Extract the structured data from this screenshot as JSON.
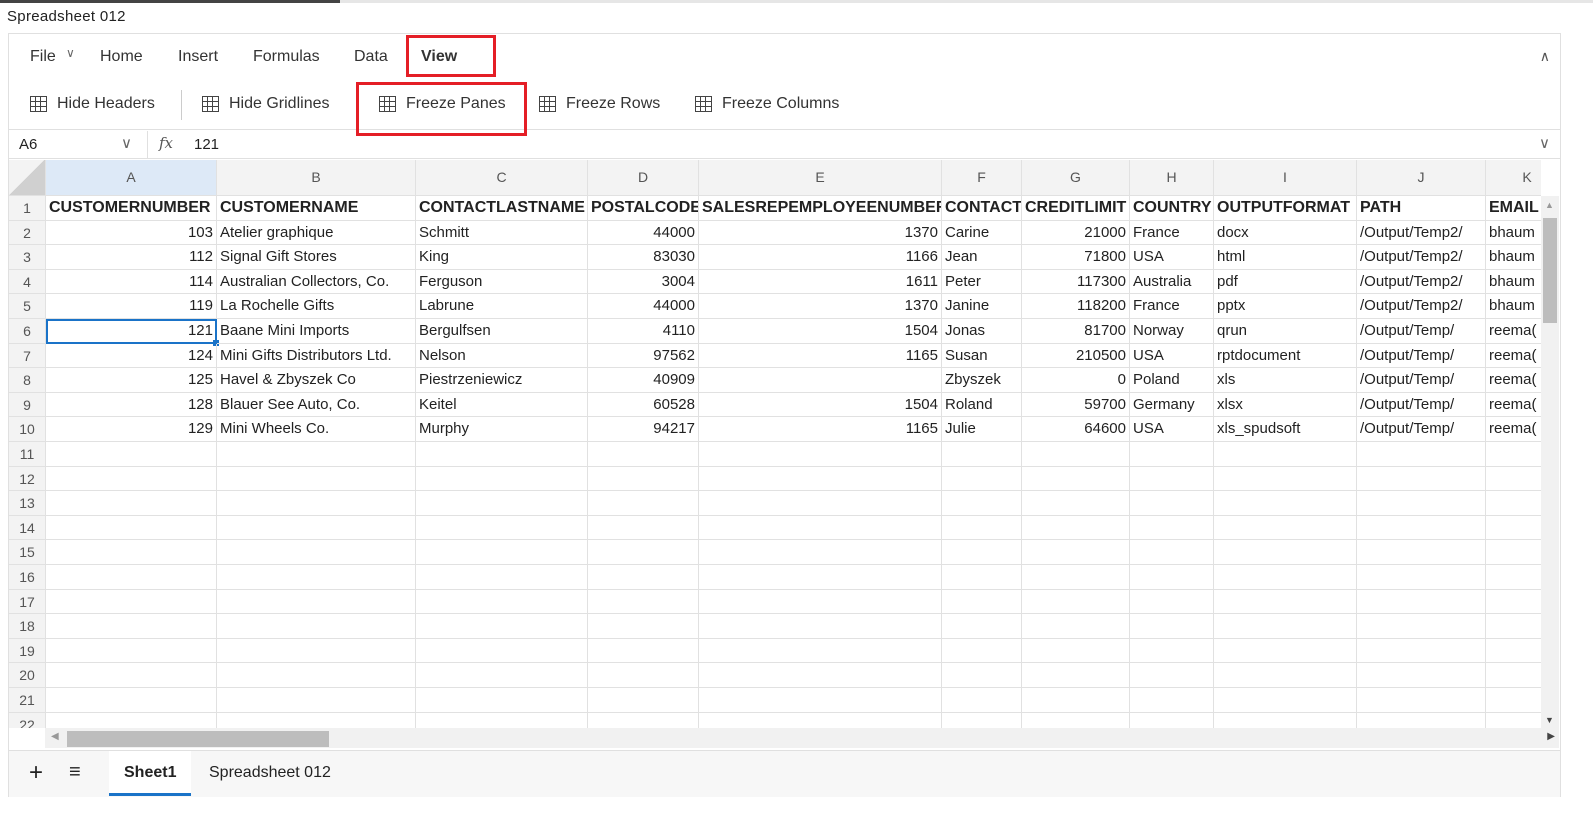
{
  "window": {
    "title": "Spreadsheet 012"
  },
  "menu": {
    "items": [
      "File",
      "Home",
      "Insert",
      "Formulas",
      "Data",
      "View"
    ],
    "active": "View",
    "file_chevron": "chevron-down-icon",
    "collapse_icon": "chevron-up-icon"
  },
  "toolbar": {
    "items": [
      "Hide Headers",
      "Hide Gridlines",
      "Freeze Panes",
      "Freeze Rows",
      "Freeze Columns"
    ]
  },
  "formula_bar": {
    "name_box": "A6",
    "fx": "fx",
    "value": "121"
  },
  "colors": {
    "highlight": "#e41e26",
    "selection": "#1a73c8"
  },
  "sheet": {
    "columns": [
      "A",
      "B",
      "C",
      "D",
      "E",
      "F",
      "G",
      "H",
      "I",
      "J",
      "K"
    ],
    "selected_cell": "A6",
    "row_numbers": [
      "1",
      "2",
      "3",
      "4",
      "5",
      "6",
      "7",
      "8",
      "9",
      "10",
      "11",
      "12",
      "13",
      "14",
      "15",
      "16",
      "17",
      "18",
      "19",
      "20",
      "21",
      "22"
    ],
    "headers": [
      "CUSTOMERNUMBER",
      "CUSTOMERNAME",
      "CONTACTLASTNAME",
      "POSTALCODE",
      "SALESREPEMPLOYEENUMBER",
      "CONTACT",
      "CREDITLIMIT",
      "COUNTRY",
      "OUTPUTFORMAT",
      "PATH",
      "EMAIL"
    ],
    "rows": [
      [
        "103",
        "Atelier graphique",
        "Schmitt",
        "44000",
        "1370",
        "Carine",
        "21000",
        "France",
        "docx",
        "/Output/Temp2/",
        "bhaum"
      ],
      [
        "112",
        "Signal Gift Stores",
        "King",
        "83030",
        "1166",
        "Jean",
        "71800",
        "USA",
        "html",
        "/Output/Temp2/",
        "bhaum"
      ],
      [
        "114",
        "Australian Collectors, Co.",
        "Ferguson",
        "3004",
        "1611",
        "Peter",
        "117300",
        "Australia",
        "pdf",
        "/Output/Temp2/",
        "bhaum"
      ],
      [
        "119",
        "La Rochelle Gifts",
        "Labrune",
        "44000",
        "1370",
        "Janine",
        "118200",
        "France",
        "pptx",
        "/Output/Temp2/",
        "bhaum"
      ],
      [
        "121",
        "Baane Mini Imports",
        "Bergulfsen",
        "4110",
        "1504",
        "Jonas",
        "81700",
        "Norway",
        "qrun",
        "/Output/Temp/",
        "reema("
      ],
      [
        "124",
        "Mini Gifts Distributors Ltd.",
        "Nelson",
        "97562",
        "1165",
        "Susan",
        "210500",
        "USA",
        "rptdocument",
        "/Output/Temp/",
        "reema("
      ],
      [
        "125",
        "Havel & Zbyszek Co",
        "Piestrzeniewicz",
        "40909",
        "",
        "Zbyszek",
        "0",
        "Poland",
        "xls",
        "/Output/Temp/",
        "reema("
      ],
      [
        "128",
        "Blauer See Auto, Co.",
        "Keitel",
        "60528",
        "1504",
        "Roland",
        "59700",
        "Germany",
        "xlsx",
        "/Output/Temp/",
        "reema("
      ],
      [
        "129",
        "Mini Wheels Co.",
        "Murphy",
        "94217",
        "1165",
        "Julie",
        "64600",
        "USA",
        "xls_spudsoft",
        "/Output/Temp/",
        "reema("
      ]
    ]
  },
  "sheet_tabs": {
    "items": [
      "Sheet1",
      "Spreadsheet 012"
    ],
    "active": "Sheet1",
    "add_icon": "plus-icon",
    "list_icon": "menu-icon"
  }
}
